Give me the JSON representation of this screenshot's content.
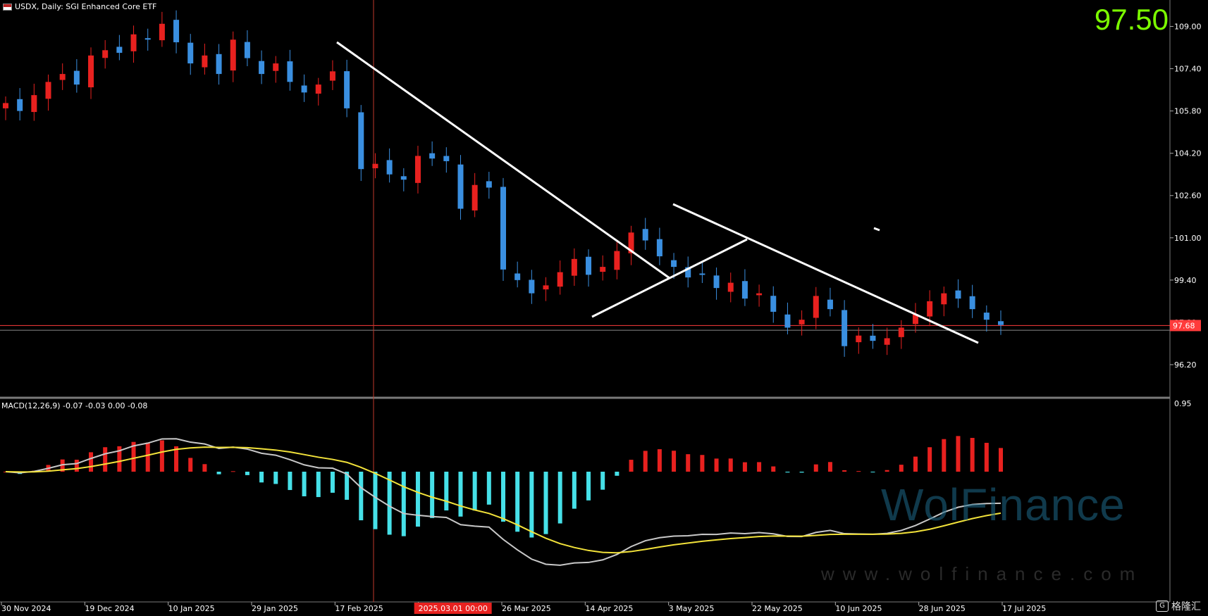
{
  "header": {
    "symbol_line": "USDX, Daily:  SGI Enhanced Core ETF",
    "flag_icon": "us-flag-icon"
  },
  "big_price": "97.50",
  "macd_label": "MACD(12,26,9) -0.07 -0.03 0.00 -0.08",
  "watermark": {
    "brand": "WolFinance",
    "url": "www.wolfinance.com"
  },
  "footer_brand": {
    "label": "格隆汇",
    "logo": "G"
  },
  "colors": {
    "up": "#e8211f",
    "down": "#3a8fe0",
    "hist_pos": "#e8211f",
    "hist_neg": "#46e0e8",
    "macd": "#c8c8c8",
    "signal": "#f2e23a",
    "trend": "#ffffff",
    "price_line": "#ff3b3b",
    "accent": "#7cfc00"
  },
  "chart_data": [
    {
      "type": "candlestick",
      "title": "USDX, Daily",
      "y_ticks": [
        "109.00",
        "107.40",
        "105.80",
        "104.20",
        "102.60",
        "101.00",
        "99.40",
        "97.80",
        "96.20"
      ],
      "current_price_tag": "97.68",
      "x_ticks": [
        "30 Nov 2024",
        "19 Dec 2024",
        "10 Jan 2025",
        "29 Jan 2025",
        "17 Feb 2025",
        "2025.03.01 00:00",
        "26 Mar 2025",
        "14 Apr 2025",
        "3 May 2025",
        "22 May 2025",
        "10 Jun 2025",
        "28 Jun 2025",
        "17 Jul 2025"
      ],
      "crosshair_label": "2025.03.01 00:00",
      "ylim": [
        95.0,
        110.0
      ],
      "close_series_approx": [
        106.1,
        105.8,
        106.4,
        106.9,
        107.2,
        106.8,
        107.9,
        108.1,
        108.0,
        108.7,
        108.5,
        109.1,
        108.4,
        107.6,
        107.9,
        107.2,
        108.5,
        107.8,
        107.2,
        107.6,
        106.9,
        106.5,
        106.8,
        107.3,
        105.9,
        103.6,
        103.8,
        103.4,
        103.2,
        104.1,
        104.0,
        103.9,
        102.1,
        103.0,
        102.9,
        99.8,
        99.4,
        98.9,
        99.2,
        99.7,
        100.2,
        99.6,
        99.9,
        100.5,
        101.2,
        100.9,
        100.3,
        99.9,
        99.5,
        99.6,
        99.1,
        99.3,
        98.7,
        98.9,
        98.2,
        97.6,
        97.9,
        98.8,
        98.3,
        96.9,
        97.3,
        97.1,
        97.2,
        97.6,
        98.1,
        98.6,
        98.9,
        98.7,
        98.3,
        97.9,
        97.7
      ]
    },
    {
      "type": "macd",
      "label": "MACD(12,26,9)",
      "values": {
        "macd": -0.07,
        "signal": -0.03,
        "hist": 0.0,
        "other": -0.08
      },
      "y_ticks": [
        "0.95"
      ]
    }
  ]
}
